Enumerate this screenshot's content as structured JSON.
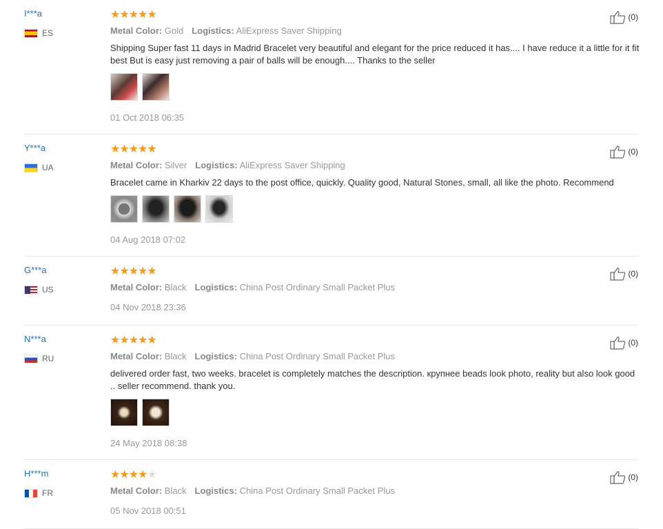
{
  "colors": {
    "star": "#f69a1a",
    "user": "#2b6fb6",
    "meta": "#999999"
  },
  "labels": {
    "metal_color": "Metal Color:",
    "logistics": "Logistics:"
  },
  "reviews": [
    {
      "user": "I***a",
      "country": "ES",
      "rating": 5,
      "metal_color": "Gold",
      "logistics": "AliExpress Saver Shipping",
      "text": "Shipping Super fast 11 days in Madrid Bracelet very beautiful and elegant for the price reduced it has.... I have reduce it a little for it fit best But is easy just removing a pair of balls will be enough.... Thanks to the seller",
      "photos": 2,
      "date": "01 Oct 2018 06:35",
      "likes": "(0)"
    },
    {
      "user": "Y***a",
      "country": "UA",
      "rating": 5,
      "metal_color": "Silver",
      "logistics": "AliExpress Saver Shipping",
      "text": "Bracelet came in Kharkiv 22 days to the post office, quickly. Quality good, Natural Stones, small, all like the photo. Recommend",
      "photos": 4,
      "date": "04 Aug 2018 07:02",
      "likes": "(0)"
    },
    {
      "user": "G***a",
      "country": "US",
      "rating": 5,
      "metal_color": "Black",
      "logistics": "China Post Ordinary Small Packet Plus",
      "text": "",
      "photos": 0,
      "date": "04 Nov 2018 23:36",
      "likes": "(0)"
    },
    {
      "user": "N***a",
      "country": "RU",
      "rating": 5,
      "metal_color": "Black",
      "logistics": "China Post Ordinary Small Packet Plus",
      "text": "delivered order fast, two weeks. bracelet is completely matches the description. крупнее beads look photo, reality but also look good .. seller recommend. thank you.",
      "photos": 2,
      "date": "24 May 2018 08:38",
      "likes": "(0)"
    },
    {
      "user": "H***m",
      "country": "FR",
      "rating": 4,
      "metal_color": "Black",
      "logistics": "China Post Ordinary Small Packet Plus",
      "text": "",
      "photos": 0,
      "date": "05 Nov 2018 00:51",
      "likes": "(0)"
    }
  ]
}
